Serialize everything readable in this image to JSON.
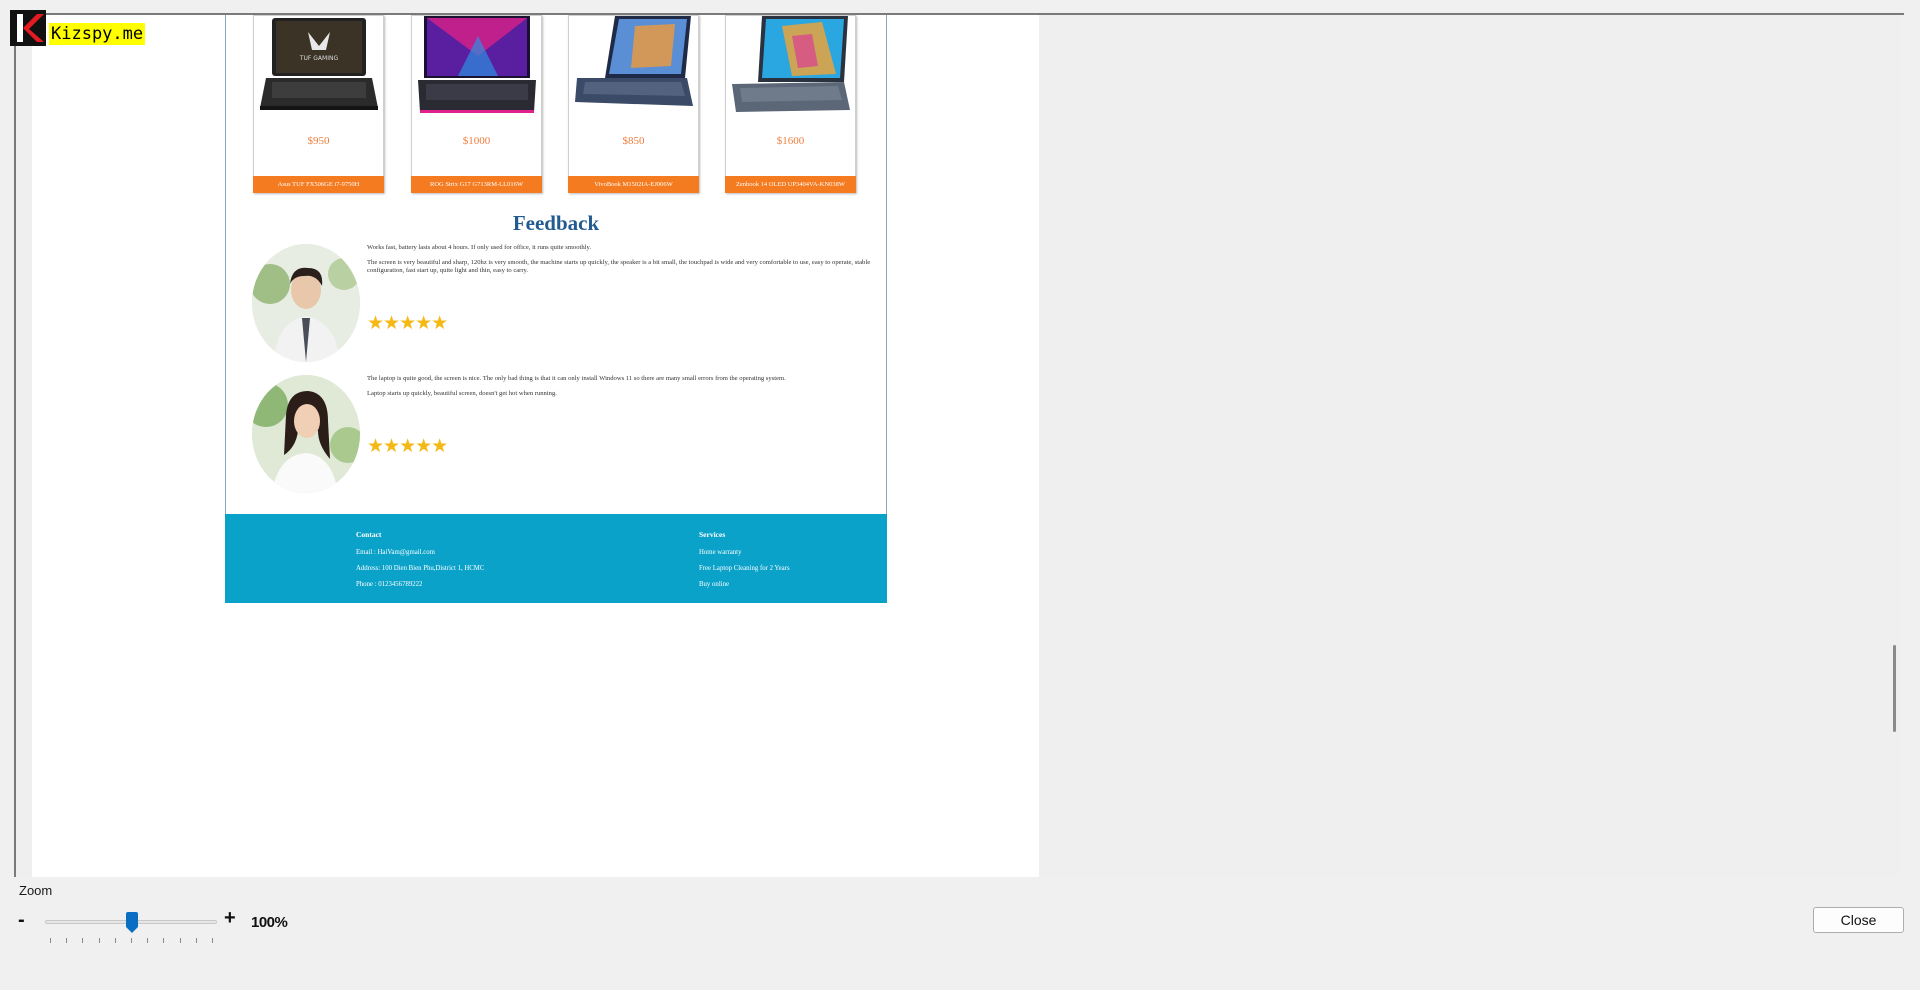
{
  "logo": {
    "text": "Kizspy.me"
  },
  "products": [
    {
      "price": "$950",
      "name": "Asus TUF FX506GE i7-9750H"
    },
    {
      "price": "$1000",
      "name": "ROG Strix G17 G713RM-LL016W"
    },
    {
      "price": "$850",
      "name": "VivoBook M1502IA-EJ006W"
    },
    {
      "price": "$1600",
      "name": "Zenbook 14 OLED UP3404VA-KN038W"
    }
  ],
  "feedback": {
    "title": "Feedback",
    "reviews": [
      {
        "lines": [
          "Works fast, battery lasts about 4 hours. If only used for office, it runs quite smoothly.",
          "The screen is very beautiful and sharp, 120hz is very smooth, the machine starts up quickly, the speaker is a bit small, the touchpad is wide and very comfortable to use, easy to operate, stable configuration, fast start up, quite light and thin, easy to carry."
        ],
        "stars": "★★★★★"
      },
      {
        "lines": [
          "The laptop is quite good, the screen is nice. The only bad thing is that it can only install Windows 11 so there are many small errors from the operating system.",
          "Laptop starts up quickly, beautiful screen, doesn't get hot when running."
        ],
        "stars": "★★★★★"
      }
    ]
  },
  "site_footer": {
    "contact": {
      "heading": "Contact",
      "email": "Email : HaiVam@gmail.com",
      "address": "Address: 100 Dien Bien Phu,District 1, HCMC",
      "phone": "Phone : 0123456789222"
    },
    "services": {
      "heading": "Services",
      "items": [
        "Home warranty",
        "Free Laptop Cleaning for 2 Years",
        "Buy online"
      ]
    }
  },
  "controls": {
    "zoom_label": "Zoom",
    "zoom_minus": "-",
    "zoom_plus": "+",
    "zoom_value": "100%",
    "zoom_level_percent": 100,
    "close_label": "Close"
  },
  "colors": {
    "accent": "#0a6fc2",
    "price": "#ef7d3c",
    "product_bar": "#f47b20",
    "footer_bg": "#0aa2c9",
    "feedback_title": "#225b8f",
    "stars": "#f5b916"
  },
  "icons": {
    "logo_mark": "kizspy-logo-icon",
    "slider": "slider-thumb-icon"
  }
}
